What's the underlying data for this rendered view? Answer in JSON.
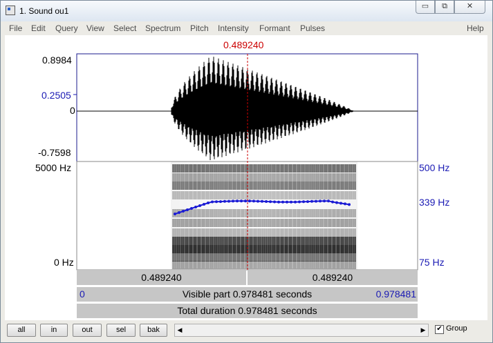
{
  "window": {
    "title": "1. Sound ou1",
    "min_glyph": "▭",
    "max_glyph": "⧉",
    "close_glyph": "✕"
  },
  "menu": [
    "File",
    "Edit",
    "Query",
    "View",
    "Select",
    "Spectrum",
    "Pitch",
    "Intensity",
    "Formant",
    "Pulses",
    "Help"
  ],
  "cursor_time": "0.489240",
  "waveform": {
    "max_label": "0.8984",
    "cursor_value": "0.2505",
    "zero_label": "0",
    "min_label": "-0.7598"
  },
  "spectrogram": {
    "top_label": "5000 Hz",
    "bottom_label": "0 Hz"
  },
  "pitch": {
    "top_label": "500 Hz",
    "value_label": "339 Hz",
    "bottom_label": "75 Hz"
  },
  "selection_bar": {
    "left": "0.489240",
    "right": "0.489240"
  },
  "visible_bar": {
    "start": "0",
    "text": "Visible part 0.978481 seconds",
    "end": "0.978481"
  },
  "total_bar": {
    "text": "Total duration 0.978481 seconds"
  },
  "buttons": {
    "all": "all",
    "in": "in",
    "out": "out",
    "sel": "sel",
    "bak": "bak"
  },
  "scrollbar": {
    "left_arrow": "◀",
    "right_arrow": "▶"
  },
  "group": {
    "label": "Group",
    "checked": true,
    "check_glyph": "✔"
  }
}
